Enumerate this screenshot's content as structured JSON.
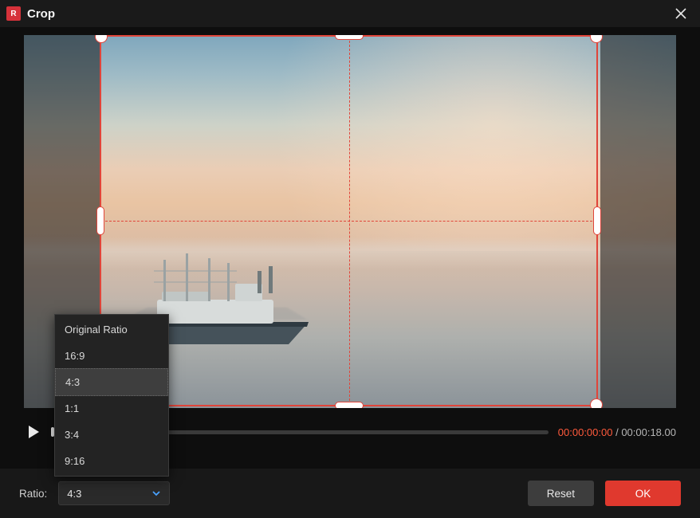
{
  "title": "Crop",
  "playback": {
    "current_time": "00:00:00:00",
    "separator": " / ",
    "duration": "00:00:18.00"
  },
  "ratio": {
    "label": "Ratio:",
    "value": "4:3",
    "options": [
      "Original Ratio",
      "16:9",
      "4:3",
      "1:1",
      "3:4",
      "9:16"
    ],
    "selected_index": 2
  },
  "buttons": {
    "reset": "Reset",
    "ok": "OK"
  }
}
